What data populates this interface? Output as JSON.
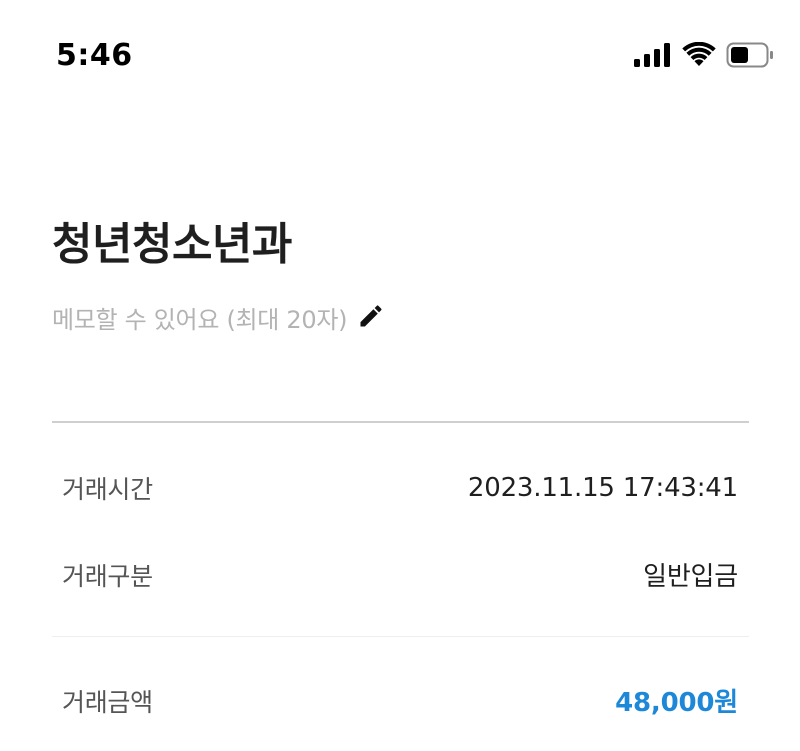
{
  "status_bar": {
    "time": "5:46",
    "icons": [
      "cellular-signal-icon",
      "wifi-icon",
      "battery-icon"
    ]
  },
  "header": {
    "title": "청년청소년과",
    "memo_placeholder": "메모할 수 있어요 (최대 20자)",
    "edit_icon": "pencil-icon"
  },
  "details": {
    "rows": [
      {
        "label": "거래시간",
        "value": "2023.11.15 17:43:41"
      },
      {
        "label": "거래구분",
        "value": "일반입금"
      },
      {
        "label": "거래금액",
        "value": "48,000원"
      }
    ]
  },
  "colors": {
    "amount": "#1e88d8",
    "memo": "#b3b3b3",
    "label": "#555555"
  }
}
